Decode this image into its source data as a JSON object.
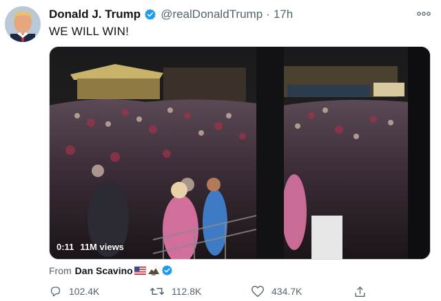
{
  "tweet": {
    "author_name": "Donald J. Trump",
    "handle": "@realDonaldTrump",
    "separator": "·",
    "time": "17h",
    "text": "WE WILL WIN!"
  },
  "media": {
    "duration": "0:11",
    "views": "11M views"
  },
  "attribution": {
    "label": "From",
    "user": "Dan Scavino"
  },
  "actions": {
    "replies": "102.4K",
    "retweets": "112.8K",
    "likes": "434.7K"
  },
  "icons": {
    "verified": "verified-badge-icon",
    "more": "more-options-icon",
    "reply": "reply-icon",
    "retweet": "retweet-icon",
    "like": "heart-icon",
    "share": "share-icon"
  },
  "colors": {
    "verified_blue": "#1d9bf0",
    "secondary_text": "#536471"
  }
}
